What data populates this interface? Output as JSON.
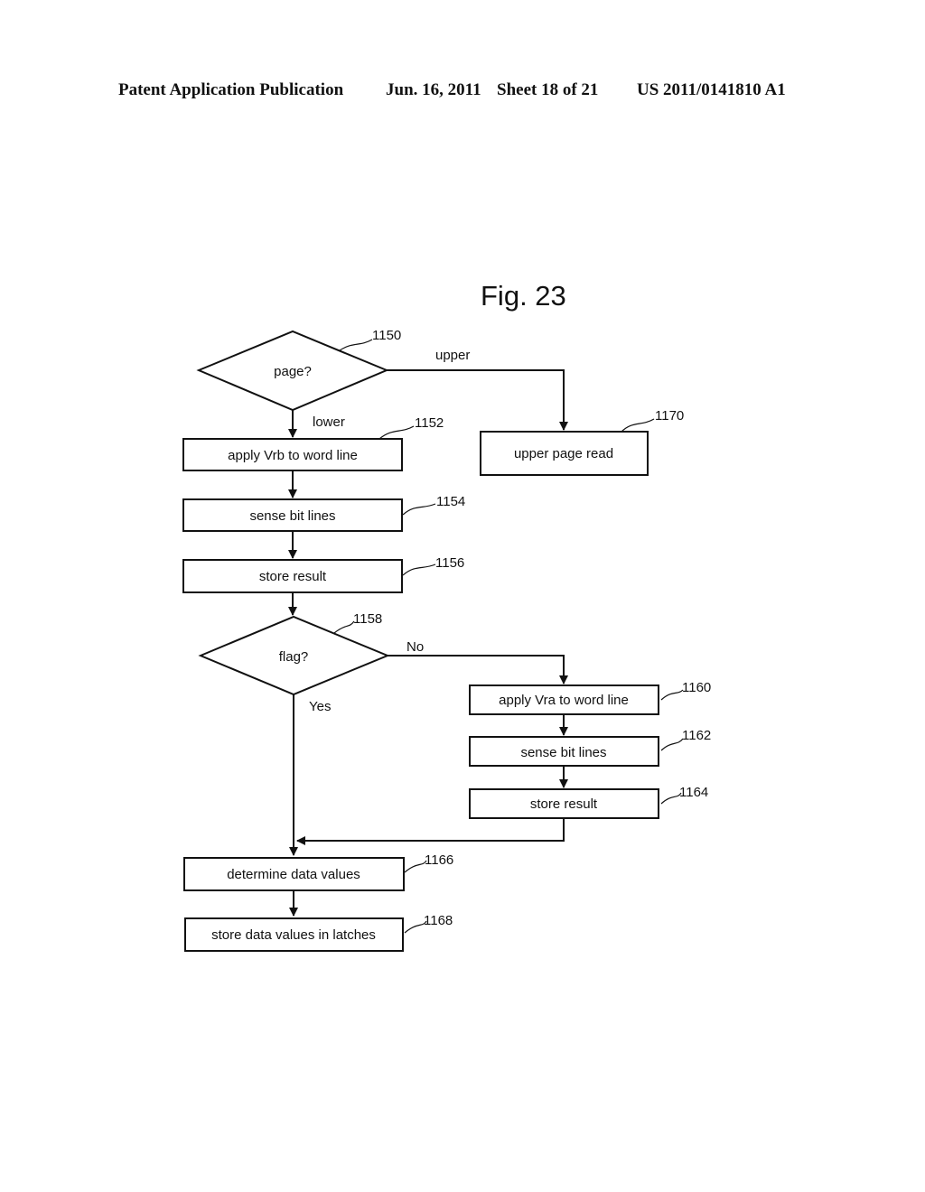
{
  "header": {
    "publication": "Patent Application Publication",
    "date": "Jun. 16, 2011",
    "sheet": "Sheet 18 of 21",
    "number": "US 2011/0141810 A1"
  },
  "figure": {
    "title": "Fig. 23",
    "nodes": {
      "n1150": {
        "ref": "1150",
        "type": "decision",
        "text": "page?"
      },
      "n1152": {
        "ref": "1152",
        "type": "process",
        "text": "apply Vrb to word line"
      },
      "n1154": {
        "ref": "1154",
        "type": "process",
        "text": "sense bit lines"
      },
      "n1156": {
        "ref": "1156",
        "type": "process",
        "text": "store result"
      },
      "n1158": {
        "ref": "1158",
        "type": "decision",
        "text": "flag?"
      },
      "n1160": {
        "ref": "1160",
        "type": "process",
        "text": "apply Vra to word line"
      },
      "n1162": {
        "ref": "1162",
        "type": "process",
        "text": "sense bit lines"
      },
      "n1164": {
        "ref": "1164",
        "type": "process",
        "text": "store result"
      },
      "n1166": {
        "ref": "1166",
        "type": "process",
        "text": "determine data values"
      },
      "n1168": {
        "ref": "1168",
        "type": "process",
        "text": "store data values in latches"
      },
      "n1170": {
        "ref": "1170",
        "type": "process",
        "text": "upper page read"
      }
    },
    "edges": {
      "upper": "upper",
      "lower": "lower",
      "no": "No",
      "yes": "Yes"
    }
  }
}
